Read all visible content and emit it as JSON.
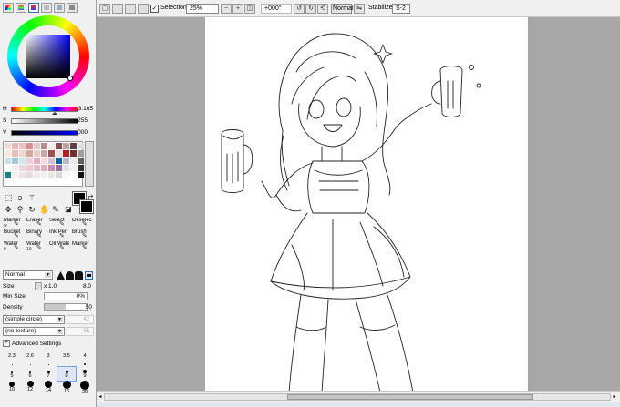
{
  "color_panel": {
    "h_label": "H",
    "h_value": "3:165",
    "s_label": "S",
    "s_value": "255",
    "v_label": "V",
    "v_value": "000"
  },
  "swatches": [
    "#f4dcdc",
    "#e8b8b8",
    "#f0c0c0",
    "#d89090",
    "#e0c8c8",
    "#b09090",
    "#f8f0f0",
    "#805050",
    "#c0a0a0",
    "#604040",
    "#e0e0e0",
    "#f8e8e0",
    "#e8c0b8",
    "#f0d8d0",
    "#d0a8a0",
    "#e8d0c8",
    "#c8a8a8",
    "#a05050",
    "#f0e0e0",
    "#b02020",
    "#703030",
    "#a0a0a0",
    "#c8e0e8",
    "#a0c8d8",
    "#d0e8f0",
    "#f0d0d8",
    "#e0b0c0",
    "#f8d8e0",
    "#d8c0d0",
    "#0a64a0",
    "#b8b8c8",
    "#f0e8e8",
    "#606060",
    "#ffffff",
    "#f0f0f0",
    "#e8d8e0",
    "#f0c8d0",
    "#e0c0c8",
    "#d8b0c0",
    "#c890a8",
    "#9870a0",
    "#e0e0e8",
    "#f0f0f0",
    "#303030",
    "#208080",
    "#f8f0f0",
    "#f0e0e8",
    "#e8d8e0",
    "#f8e8f0",
    "#f0f0f0",
    "#e8e8e8",
    "#d8d8d8",
    "#f8f8f8",
    "#ffffff",
    "#101010"
  ],
  "tools": [
    {
      "label": "Marker",
      "size": "w",
      "selected": false
    },
    {
      "label": "Eraser",
      "size": "",
      "selected": false
    },
    {
      "label": "Select",
      "size": "",
      "selected": false
    },
    {
      "label": "Deselect",
      "size": "",
      "selected": false
    },
    {
      "label": "Bucket",
      "size": "",
      "selected": false
    },
    {
      "label": "Binary",
      "size": "",
      "selected": false
    },
    {
      "label": "Ink Pen",
      "size": "",
      "selected": false
    },
    {
      "label": "Brush",
      "size": "",
      "selected": false
    },
    {
      "label": "Water",
      "size": "9",
      "selected": false
    },
    {
      "label": "Water",
      "size": "10",
      "selected": false
    },
    {
      "label": "Oil Wate",
      "size": "",
      "selected": false
    },
    {
      "label": "Marker",
      "size": "",
      "selected": false
    }
  ],
  "blend_mode": "Normal",
  "params": {
    "size_label": "Size",
    "size_mult": "x 1.0",
    "size_value": "8.0",
    "min_size_label": "Min Size",
    "min_size_value": "0%",
    "density_label": "Density",
    "density_value": "50",
    "density_fill": 0.5,
    "brush_shape": "(simple circle)",
    "brush_shape_value": "42",
    "texture": "(no texture)",
    "texture_value": "95",
    "advanced_label": "Advanced Settings"
  },
  "size_presets": [
    {
      "label": "2.3",
      "d": 1,
      "sel": false
    },
    {
      "label": "2.6",
      "d": 1,
      "sel": false
    },
    {
      "label": "3",
      "d": 1,
      "sel": false
    },
    {
      "label": "3.5",
      "d": 1,
      "sel": false
    },
    {
      "label": "4",
      "d": 2,
      "sel": false
    },
    {
      "label": "5",
      "d": 2,
      "sel": false
    },
    {
      "label": "6",
      "d": 2,
      "sel": false
    },
    {
      "label": "7",
      "d": 3,
      "sel": false
    },
    {
      "label": "8",
      "d": 3,
      "sel": true
    },
    {
      "label": "9",
      "d": 4,
      "sel": false
    },
    {
      "label": "10",
      "d": 6,
      "sel": false
    },
    {
      "label": "12",
      "d": 7,
      "sel": false
    },
    {
      "label": "14",
      "d": 8,
      "sel": false
    },
    {
      "label": "16",
      "d": 9,
      "sel": false
    },
    {
      "label": "20",
      "d": 10,
      "sel": false
    }
  ],
  "toolbar": {
    "selection_label": "Selection",
    "zoom": "25%",
    "rotation": "+000°",
    "mode": "Normal",
    "stabilizer_label": "Stabilizer",
    "stabilizer_value": "S-2"
  },
  "colors": {
    "canvas_bg": "#a7a7a7",
    "paper": "#ffffff",
    "accent": "#3a6ea5"
  }
}
